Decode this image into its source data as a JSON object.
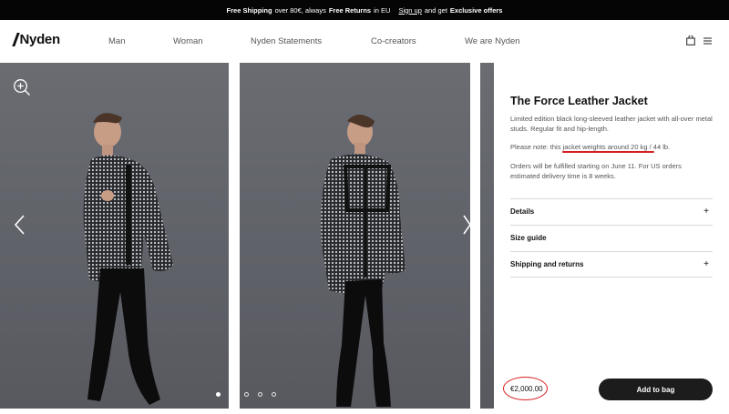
{
  "promo": {
    "free_shipping": "Free Shipping",
    "over_text": "over 80€, always",
    "free_returns": "Free Returns",
    "in_eu": "in EU",
    "signup": "Sign up",
    "and_get": "and get",
    "exclusive": "Exclusive offers"
  },
  "nav": {
    "logo": "Nyden",
    "items": [
      {
        "label": "Man"
      },
      {
        "label": "Woman"
      },
      {
        "label": "Nyden Statements"
      },
      {
        "label": "Co-creators"
      },
      {
        "label": "We are Nyden"
      }
    ]
  },
  "gallery": {
    "dots": [
      true,
      false,
      false,
      false
    ]
  },
  "product": {
    "title": "The Force Leather Jacket",
    "description_1": "Limited edition black long-sleeved leather jacket with all-over metal studs. Regular fit and hip-length.",
    "note_prefix": "Please note: this jacket",
    "note_weight": "weights around 20 kg",
    "note_suffix": "/ 44 lb.",
    "orders_note": "Orders will be fulfilled starting on June 11. For US orders estimated delivery time is 8 weeks.",
    "sections": [
      {
        "label": "Details",
        "has_plus": true
      },
      {
        "label": "Size guide",
        "has_plus": false
      },
      {
        "label": "Shipping and returns",
        "has_plus": true
      }
    ],
    "price": "€2,000.00",
    "add_to_bag": "Add to bag"
  },
  "colors": {
    "highlight": "#d62020",
    "button": "#1c1c1c",
    "photo_bg": "#63656b"
  }
}
